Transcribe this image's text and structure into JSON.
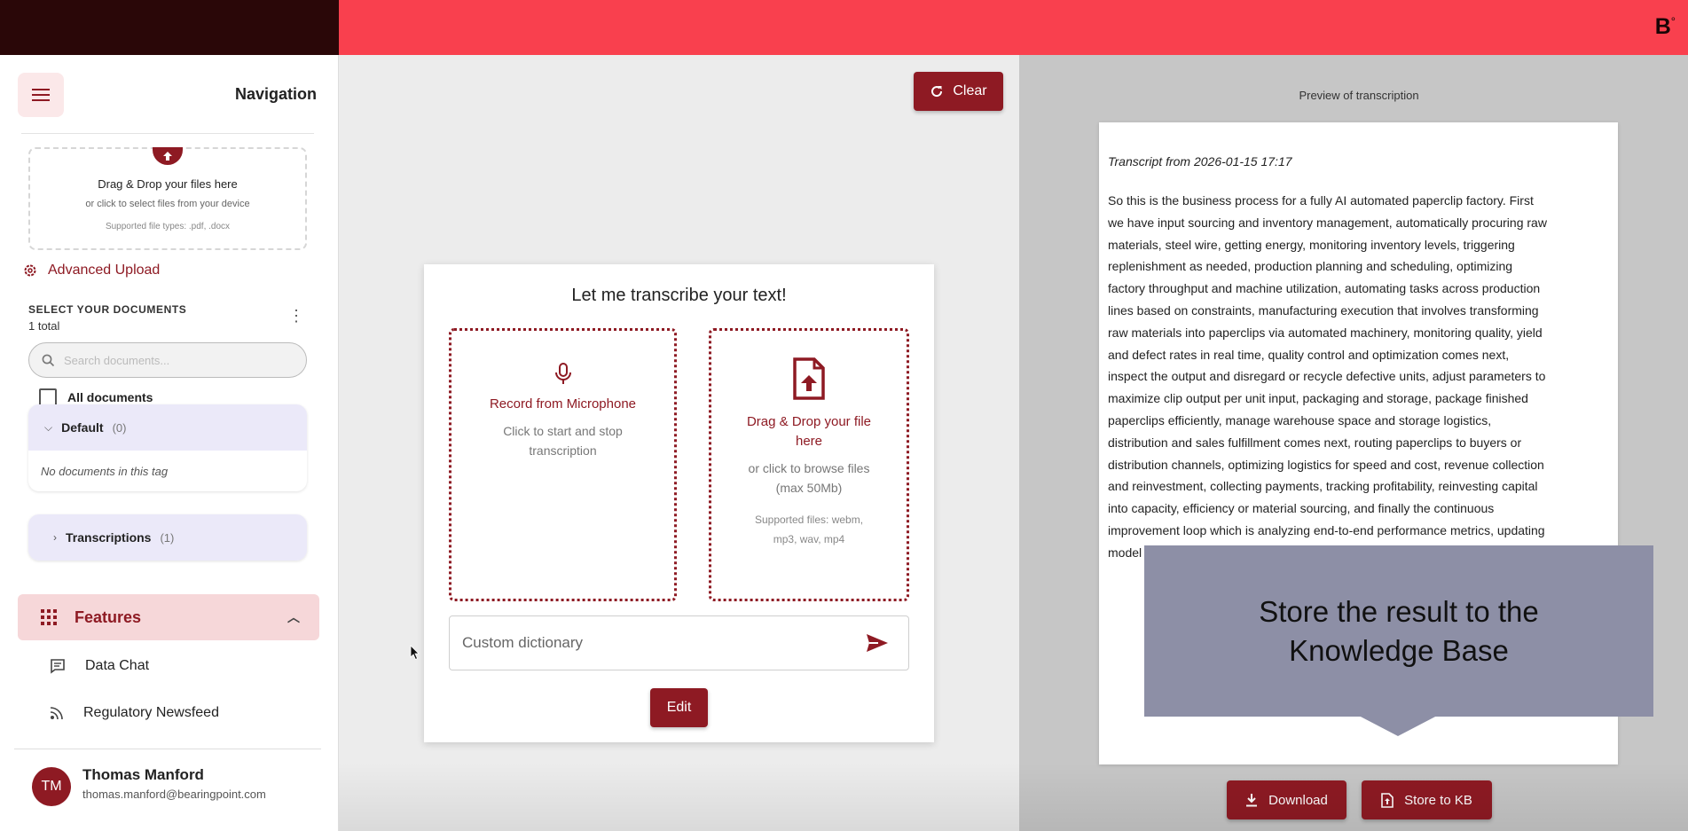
{
  "brand": {
    "logo_text": "B",
    "logo_mark": "°"
  },
  "sidebar": {
    "nav_title": "Navigation",
    "upload": {
      "title": "Drag & Drop your files here",
      "subtitle": "or click to select files from your device",
      "types": "Supported file types: .pdf, .docx"
    },
    "advanced_upload_label": "Advanced Upload",
    "select_docs_label": "SELECT YOUR DOCUMENTS",
    "total_label": "1 total",
    "search_placeholder": "Search documents...",
    "all_docs_label": "All documents",
    "tags": [
      {
        "name": "Default",
        "count": "(0)",
        "empty_text": "No documents in this tag"
      },
      {
        "name": "Transcriptions",
        "count": "(1)"
      }
    ],
    "features_label": "Features",
    "feature_items": [
      {
        "label": "Data Chat",
        "icon": "chat-icon"
      },
      {
        "label": "Regulatory Newsfeed",
        "icon": "rss-icon"
      }
    ],
    "user": {
      "initials": "TM",
      "name": "Thomas Manford",
      "email": "thomas.manford@bearingpoint.com"
    }
  },
  "center": {
    "clear_label": "Clear",
    "card_title": "Let me transcribe your text!",
    "record": {
      "title": "Record from Microphone",
      "subtitle_1": "Click to start and stop",
      "subtitle_2": "transcription"
    },
    "file": {
      "title_1": "Drag & Drop your file",
      "title_2": "here",
      "subtitle_1": "or click to browse files",
      "subtitle_2": "(max 50Mb)",
      "types_1": "Supported files: webm,",
      "types_2": "mp3, wav, mp4"
    },
    "dictionary_placeholder": "Custom dictionary",
    "edit_label": "Edit"
  },
  "preview": {
    "label": "Preview of transcription",
    "heading": "Transcript from 2026-01-15 17:17",
    "lines": [
      "So this is the business process for a fully AI automated paperclip factory. First",
      "we have input sourcing and inventory management, automatically procuring raw",
      "materials, steel wire, getting energy, monitoring inventory levels, triggering",
      "replenishment as needed, production planning and scheduling, optimizing",
      "factory throughput and machine utilization, automating tasks across production",
      "lines based on constraints, manufacturing execution that involves transforming",
      "raw materials into paperclips via automated machinery, monitoring quality, yield",
      "and defect rates in real time, quality control and optimization comes next,",
      "inspect the output and disregard or recycle defective units, adjust parameters to",
      "maximize clip output per unit input, packaging and storage, package finished",
      "paperclips efficiently, manage warehouse space and storage logistics,",
      "distribution and sales fulfillment comes next, routing paperclips to buyers or",
      "distribution channels, optimizing logistics for speed and cost, revenue collection",
      "and reinvestment, collecting payments, tracking profitability, reinvesting capital",
      "into capacity, efficiency or material sourcing, and finally the continuous",
      "improvement loop which is analyzing end-to-end performance metrics, updating",
      "model"
    ],
    "tooltip_line_1": "Store the result to the",
    "tooltip_line_2": "Knowledge Base",
    "download_label": "Download",
    "store_label": "Store to KB"
  },
  "colors": {
    "accent": "#8e1a23",
    "topbar": "#f9404e",
    "topbar_dark": "#2a0708",
    "tooltip": "#8d8fa6"
  }
}
